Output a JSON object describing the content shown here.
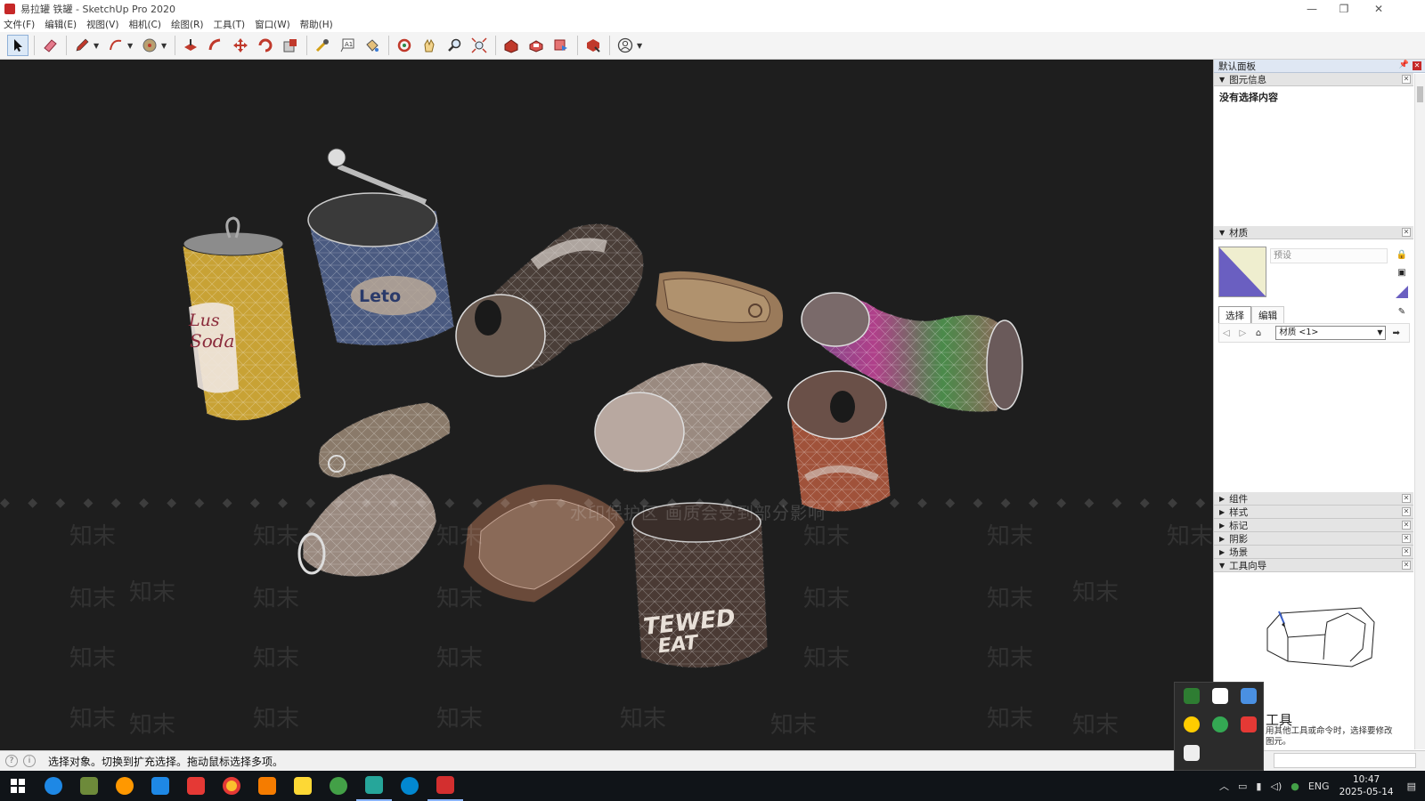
{
  "window": {
    "title": "易拉罐 铁罐 - SketchUp Pro 2020",
    "controls": [
      "—",
      "❐",
      "✕"
    ]
  },
  "menu": [
    "文件(F)",
    "编辑(E)",
    "视图(V)",
    "相机(C)",
    "绘图(R)",
    "工具(T)",
    "窗口(W)",
    "帮助(H)"
  ],
  "toolbar": {
    "tools": [
      "select-icon",
      "eraser-icon",
      "pencil-icon",
      "arc-icon",
      "shapes-icon",
      "push-pull-icon",
      "follow-me-icon",
      "move-icon",
      "rotate-icon",
      "scale-icon",
      "tape-measure-icon",
      "text-icon",
      "paint-bucket-icon",
      "orbit-icon",
      "pan-icon",
      "zoom-icon",
      "zoom-extents-icon",
      "warehouse-icon",
      "extension-warehouse-icon",
      "layout-icon",
      "extension-manager-icon",
      "account-icon"
    ]
  },
  "viewport": {
    "watermark": "知末",
    "banner": "水印保护区  画质会受到部分影响",
    "diamonds": "◆ ◆ ◆ ◆ ◆ ◆ ◆ ◆ ◆ ◆ ◆ ◆ ◆ ◆ ◆ ◆ ◆ ◆ ◆ ◆ ◆ ◆ ◆ ◆ ◆ ◆ ◆ ◆ ◆ ◆ ◆ ◆ ◆ ◆ ◆ ◆ ◆ ◆ ◆ ◆ ◆ ◆ ◆ ◆ ◆ ◆ ◆ ◆ ◆ ◆ ◆ ◆ ◆ ◆ ◆ ◆ ◆ ◆ ◆ ◆ ◆ ◆",
    "can_texts": {
      "soda": "Soda",
      "soda_top": "Lus",
      "blue": "Leto",
      "stewed": "TEWED",
      "meat": "EAT"
    }
  },
  "panel": {
    "title": "默认面板",
    "entity_info": {
      "header": "图元信息",
      "content": "没有选择内容"
    },
    "materials": {
      "header": "材质",
      "name_placeholder": "预设",
      "tab_select": "选择",
      "tab_edit": "编辑",
      "dropdown": "材质 <1>"
    },
    "collapsed_sections": [
      "组件",
      "样式",
      "标记",
      "阴影",
      "场景"
    ],
    "tool_guide": {
      "header": "工具向导",
      "title": "工具",
      "text": "用其他工具或命令时，选择要修改图元。"
    }
  },
  "status": {
    "message": "选择对象。切换到扩充选择。拖动鼠标选择多项。"
  },
  "taskbar": {
    "apps": [
      "ie-icon",
      "image-viewer-icon",
      "media-player-icon",
      "security-icon",
      "video-icon",
      "chrome-icon",
      "app-orange-icon",
      "file-explorer-icon",
      "wechat-icon",
      "3dsmax-icon",
      "edge-icon",
      "sketchup-icon"
    ],
    "language": "ENG",
    "time": "10:47",
    "date": "2025-05-14"
  },
  "colors": {
    "accent": "#c62828",
    "viewport_bg": "#1e1e1e",
    "material_swatch": "#6a5fc1"
  }
}
